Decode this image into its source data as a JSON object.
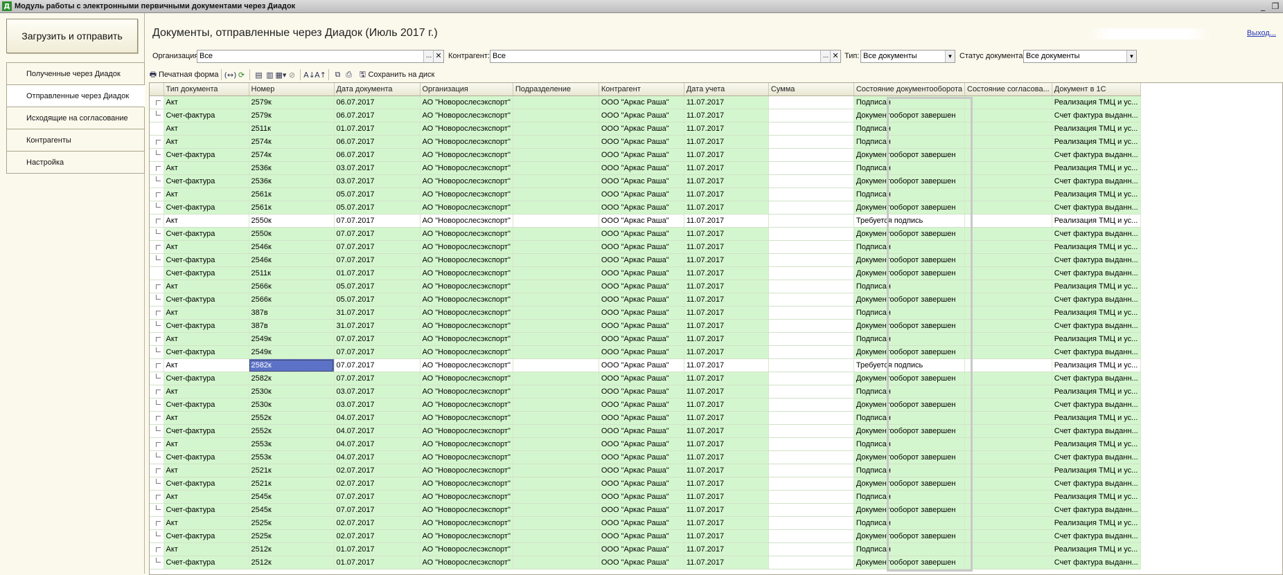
{
  "window": {
    "icon_letter": "Д",
    "title": "Модуль работы с электронными первичными документами через Диадок",
    "minimize": "_",
    "restore": "❐"
  },
  "left": {
    "upload_button": "Загрузить и отправить",
    "nav": [
      {
        "label": "Полученные через Диадок",
        "active": false
      },
      {
        "label": "Отправленные через Диадок",
        "active": true
      },
      {
        "label": "Исходящие на  согласование",
        "active": false
      },
      {
        "label": "Контрагенты",
        "active": false
      },
      {
        "label": "Настройка",
        "active": false
      }
    ]
  },
  "header": {
    "title": "Документы, отправленные через Диадок (Июль 2017 г.)",
    "exit": "Выход..."
  },
  "filters": {
    "org_label": "Организация:",
    "org_value": "Все",
    "contractor_label": "Контрагент:",
    "contractor_value": "Все",
    "type_label": "Тип:",
    "type_value": "Все документы",
    "status_label": "Статус документа:",
    "status_value": "Все документы"
  },
  "toolbar": {
    "print_form": "Печатная форма",
    "save_to_disk": "Сохранить на диск"
  },
  "table": {
    "columns": [
      "",
      "Тип документа",
      "Номер",
      "Дата документа",
      "Организация",
      "Подразделение",
      "Контрагент",
      "Дата учета",
      "Сумма",
      "Состояние документооборота",
      "Состояние согласова...",
      "Документ в 1С"
    ],
    "rows": [
      {
        "t": "Акт",
        "n": "2579к",
        "d": "06.07.2017",
        "o": "АО \"Новорослесэкспорт\"",
        "c": "ООО \"Аркас Раша\"",
        "du": "11.07.2017",
        "s": "Подписан",
        "doc": "Реализация ТМЦ и ус...",
        "tree": "top",
        "hl": false,
        "sel": false
      },
      {
        "t": "Счет-фактура",
        "n": "2579к",
        "d": "06.07.2017",
        "o": "АО \"Новорослесэкспорт\"",
        "c": "ООО \"Аркас Раша\"",
        "du": "11.07.2017",
        "s": "Документооборот завершен",
        "doc": "Счет фактура выданн...",
        "tree": "bottom",
        "hl": false,
        "sel": false
      },
      {
        "t": "Акт",
        "n": "2511к",
        "d": "01.07.2017",
        "o": "АО \"Новорослесэкспорт\"",
        "c": "ООО \"Аркас Раша\"",
        "du": "11.07.2017",
        "s": "Подписан",
        "doc": "Реализация ТМЦ и ус...",
        "tree": "none",
        "hl": false,
        "sel": false
      },
      {
        "t": "Акт",
        "n": "2574к",
        "d": "06.07.2017",
        "o": "АО \"Новорослесэкспорт\"",
        "c": "ООО \"Аркас Раша\"",
        "du": "11.07.2017",
        "s": "Подписан",
        "doc": "Реализация ТМЦ и ус...",
        "tree": "top",
        "hl": false,
        "sel": false
      },
      {
        "t": "Счет-фактура",
        "n": "2574к",
        "d": "06.07.2017",
        "o": "АО \"Новорослесэкспорт\"",
        "c": "ООО \"Аркас Раша\"",
        "du": "11.07.2017",
        "s": "Документооборот завершен",
        "doc": "Счет фактура выданн...",
        "tree": "bottom",
        "hl": false,
        "sel": false
      },
      {
        "t": "Акт",
        "n": "2536к",
        "d": "03.07.2017",
        "o": "АО \"Новорослесэкспорт\"",
        "c": "ООО \"Аркас Раша\"",
        "du": "11.07.2017",
        "s": "Подписан",
        "doc": "Реализация ТМЦ и ус...",
        "tree": "top",
        "hl": false,
        "sel": false
      },
      {
        "t": "Счет-фактура",
        "n": "2536к",
        "d": "03.07.2017",
        "o": "АО \"Новорослесэкспорт\"",
        "c": "ООО \"Аркас Раша\"",
        "du": "11.07.2017",
        "s": "Документооборот завершен",
        "doc": "Счет фактура выданн...",
        "tree": "bottom",
        "hl": false,
        "sel": false
      },
      {
        "t": "Акт",
        "n": "2561к",
        "d": "05.07.2017",
        "o": "АО \"Новорослесэкспорт\"",
        "c": "ООО \"Аркас Раша\"",
        "du": "11.07.2017",
        "s": "Подписан",
        "doc": "Реализация ТМЦ и ус...",
        "tree": "top",
        "hl": false,
        "sel": false
      },
      {
        "t": "Счет-фактура",
        "n": "2561к",
        "d": "05.07.2017",
        "o": "АО \"Новорослесэкспорт\"",
        "c": "ООО \"Аркас Раша\"",
        "du": "11.07.2017",
        "s": "Документооборот завершен",
        "doc": "Счет фактура выданн...",
        "tree": "bottom",
        "hl": false,
        "sel": false
      },
      {
        "t": "Акт",
        "n": "2550к",
        "d": "07.07.2017",
        "o": "АО \"Новорослесэкспорт\"",
        "c": "ООО \"Аркас Раша\"",
        "du": "11.07.2017",
        "s": "Требуется подпись",
        "doc": "Реализация ТМЦ и ус...",
        "tree": "top",
        "hl": true,
        "sel": false
      },
      {
        "t": "Счет-фактура",
        "n": "2550к",
        "d": "07.07.2017",
        "o": "АО \"Новорослесэкспорт\"",
        "c": "ООО \"Аркас Раша\"",
        "du": "11.07.2017",
        "s": "Документооборот завершен",
        "doc": "Счет фактура выданн...",
        "tree": "bottom",
        "hl": false,
        "sel": false
      },
      {
        "t": "Акт",
        "n": "2546к",
        "d": "07.07.2017",
        "o": "АО \"Новорослесэкспорт\"",
        "c": "ООО \"Аркас Раша\"",
        "du": "11.07.2017",
        "s": "Подписан",
        "doc": "Реализация ТМЦ и ус...",
        "tree": "top",
        "hl": false,
        "sel": false
      },
      {
        "t": "Счет-фактура",
        "n": "2546к",
        "d": "07.07.2017",
        "o": "АО \"Новорослесэкспорт\"",
        "c": "ООО \"Аркас Раша\"",
        "du": "11.07.2017",
        "s": "Документооборот завершен",
        "doc": "Счет фактура выданн...",
        "tree": "bottom",
        "hl": false,
        "sel": false
      },
      {
        "t": "Счет-фактура",
        "n": "2511к",
        "d": "01.07.2017",
        "o": "АО \"Новорослесэкспорт\"",
        "c": "ООО \"Аркас Раша\"",
        "du": "11.07.2017",
        "s": "Документооборот завершен",
        "doc": "Счет фактура выданн...",
        "tree": "none",
        "hl": false,
        "sel": false
      },
      {
        "t": "Акт",
        "n": "2566к",
        "d": "05.07.2017",
        "o": "АО \"Новорослесэкспорт\"",
        "c": "ООО \"Аркас Раша\"",
        "du": "11.07.2017",
        "s": "Подписан",
        "doc": "Реализация ТМЦ и ус...",
        "tree": "top",
        "hl": false,
        "sel": false
      },
      {
        "t": "Счет-фактура",
        "n": "2566к",
        "d": "05.07.2017",
        "o": "АО \"Новорослесэкспорт\"",
        "c": "ООО \"Аркас Раша\"",
        "du": "11.07.2017",
        "s": "Документооборот завершен",
        "doc": "Счет фактура выданн...",
        "tree": "bottom",
        "hl": false,
        "sel": false
      },
      {
        "t": "Акт",
        "n": "387в",
        "d": "31.07.2017",
        "o": "АО \"Новорослесэкспорт\"",
        "c": "ООО \"Аркас Раша\"",
        "du": "11.07.2017",
        "s": "Подписан",
        "doc": "Реализация ТМЦ и ус...",
        "tree": "top",
        "hl": false,
        "sel": false
      },
      {
        "t": "Счет-фактура",
        "n": "387в",
        "d": "31.07.2017",
        "o": "АО \"Новорослесэкспорт\"",
        "c": "ООО \"Аркас Раша\"",
        "du": "11.07.2017",
        "s": "Документооборот завершен",
        "doc": "Счет фактура выданн...",
        "tree": "bottom",
        "hl": false,
        "sel": false
      },
      {
        "t": "Акт",
        "n": "2549к",
        "d": "07.07.2017",
        "o": "АО \"Новорослесэкспорт\"",
        "c": "ООО \"Аркас Раша\"",
        "du": "11.07.2017",
        "s": "Подписан",
        "doc": "Реализация ТМЦ и ус...",
        "tree": "top",
        "hl": false,
        "sel": false
      },
      {
        "t": "Счет-фактура",
        "n": "2549к",
        "d": "07.07.2017",
        "o": "АО \"Новорослесэкспорт\"",
        "c": "ООО \"Аркас Раша\"",
        "du": "11.07.2017",
        "s": "Документооборот завершен",
        "doc": "Счет фактура выданн...",
        "tree": "bottom",
        "hl": false,
        "sel": false
      },
      {
        "t": "Акт",
        "n": "2582к",
        "d": "07.07.2017",
        "o": "АО \"Новорослесэкспорт\"",
        "c": "ООО \"Аркас Раша\"",
        "du": "11.07.2017",
        "s": "Требуется подпись",
        "doc": "Реализация ТМЦ и ус...",
        "tree": "top",
        "hl": true,
        "sel": true
      },
      {
        "t": "Счет-фактура",
        "n": "2582к",
        "d": "07.07.2017",
        "o": "АО \"Новорослесэкспорт\"",
        "c": "ООО \"Аркас Раша\"",
        "du": "11.07.2017",
        "s": "Документооборот завершен",
        "doc": "Счет фактура выданн...",
        "tree": "bottom",
        "hl": false,
        "sel": false
      },
      {
        "t": "Акт",
        "n": "2530к",
        "d": "03.07.2017",
        "o": "АО \"Новорослесэкспорт\"",
        "c": "ООО \"Аркас Раша\"",
        "du": "11.07.2017",
        "s": "Подписан",
        "doc": "Реализация ТМЦ и ус...",
        "tree": "top",
        "hl": false,
        "sel": false
      },
      {
        "t": "Счет-фактура",
        "n": "2530к",
        "d": "03.07.2017",
        "o": "АО \"Новорослесэкспорт\"",
        "c": "ООО \"Аркас Раша\"",
        "du": "11.07.2017",
        "s": "Документооборот завершен",
        "doc": "Счет фактура выданн...",
        "tree": "bottom",
        "hl": false,
        "sel": false
      },
      {
        "t": "Акт",
        "n": "2552к",
        "d": "04.07.2017",
        "o": "АО \"Новорослесэкспорт\"",
        "c": "ООО \"Аркас Раша\"",
        "du": "11.07.2017",
        "s": "Подписан",
        "doc": "Реализация ТМЦ и ус...",
        "tree": "top",
        "hl": false,
        "sel": false
      },
      {
        "t": "Счет-фактура",
        "n": "2552к",
        "d": "04.07.2017",
        "o": "АО \"Новорослесэкспорт\"",
        "c": "ООО \"Аркас Раша\"",
        "du": "11.07.2017",
        "s": "Документооборот завершен",
        "doc": "Счет фактура выданн...",
        "tree": "bottom",
        "hl": false,
        "sel": false
      },
      {
        "t": "Акт",
        "n": "2553к",
        "d": "04.07.2017",
        "o": "АО \"Новорослесэкспорт\"",
        "c": "ООО \"Аркас Раша\"",
        "du": "11.07.2017",
        "s": "Подписан",
        "doc": "Реализация ТМЦ и ус...",
        "tree": "top",
        "hl": false,
        "sel": false
      },
      {
        "t": "Счет-фактура",
        "n": "2553к",
        "d": "04.07.2017",
        "o": "АО \"Новорослесэкспорт\"",
        "c": "ООО \"Аркас Раша\"",
        "du": "11.07.2017",
        "s": "Документооборот завершен",
        "doc": "Счет фактура выданн...",
        "tree": "bottom",
        "hl": false,
        "sel": false
      },
      {
        "t": "Акт",
        "n": "2521к",
        "d": "02.07.2017",
        "o": "АО \"Новорослесэкспорт\"",
        "c": "ООО \"Аркас Раша\"",
        "du": "11.07.2017",
        "s": "Подписан",
        "doc": "Реализация ТМЦ и ус...",
        "tree": "top",
        "hl": false,
        "sel": false
      },
      {
        "t": "Счет-фактура",
        "n": "2521к",
        "d": "02.07.2017",
        "o": "АО \"Новорослесэкспорт\"",
        "c": "ООО \"Аркас Раша\"",
        "du": "11.07.2017",
        "s": "Документооборот завершен",
        "doc": "Счет фактура выданн...",
        "tree": "bottom",
        "hl": false,
        "sel": false
      },
      {
        "t": "Акт",
        "n": "2545к",
        "d": "07.07.2017",
        "o": "АО \"Новорослесэкспорт\"",
        "c": "ООО \"Аркас Раша\"",
        "du": "11.07.2017",
        "s": "Подписан",
        "doc": "Реализация ТМЦ и ус...",
        "tree": "top",
        "hl": false,
        "sel": false
      },
      {
        "t": "Счет-фактура",
        "n": "2545к",
        "d": "07.07.2017",
        "o": "АО \"Новорослесэкспорт\"",
        "c": "ООО \"Аркас Раша\"",
        "du": "11.07.2017",
        "s": "Документооборот завершен",
        "doc": "Счет фактура выданн...",
        "tree": "bottom",
        "hl": false,
        "sel": false
      },
      {
        "t": "Акт",
        "n": "2525к",
        "d": "02.07.2017",
        "o": "АО \"Новорослесэкспорт\"",
        "c": "ООО \"Аркас Раша\"",
        "du": "11.07.2017",
        "s": "Подписан",
        "doc": "Реализация ТМЦ и ус...",
        "tree": "top",
        "hl": false,
        "sel": false
      },
      {
        "t": "Счет-фактура",
        "n": "2525к",
        "d": "02.07.2017",
        "o": "АО \"Новорослесэкспорт\"",
        "c": "ООО \"Аркас Раша\"",
        "du": "11.07.2017",
        "s": "Документооборот завершен",
        "doc": "Счет фактура выданн...",
        "tree": "bottom",
        "hl": false,
        "sel": false
      },
      {
        "t": "Акт",
        "n": "2512к",
        "d": "01.07.2017",
        "o": "АО \"Новорослесэкспорт\"",
        "c": "ООО \"Аркас Раша\"",
        "du": "11.07.2017",
        "s": "Подписан",
        "doc": "Реализация ТМЦ и ус...",
        "tree": "top",
        "hl": false,
        "sel": false
      },
      {
        "t": "Счет-фактура",
        "n": "2512к",
        "d": "01.07.2017",
        "o": "АО \"Новорослесэкспорт\"",
        "c": "ООО \"Аркас Раша\"",
        "du": "11.07.2017",
        "s": "Документооборот завершен",
        "doc": "Счет фактура выданн...",
        "tree": "bottom",
        "hl": false,
        "sel": false
      }
    ]
  }
}
